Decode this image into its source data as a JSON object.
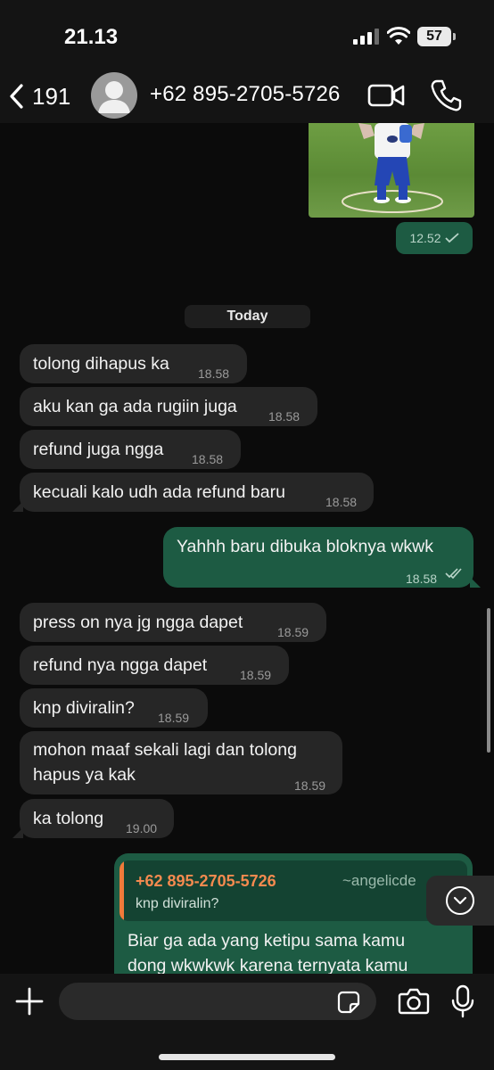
{
  "status_bar": {
    "time": "21.13",
    "battery": "57"
  },
  "header": {
    "back_count": "191",
    "contact_name": "+62 895-2705-5726"
  },
  "image_message": {
    "time": "12.52"
  },
  "date_separator": "Today",
  "messages": [
    {
      "text": "tolong dihapus ka",
      "time": "18.58"
    },
    {
      "text": "aku kan ga ada rugiin juga",
      "time": "18.58"
    },
    {
      "text": "refund juga ngga",
      "time": "18.58"
    },
    {
      "text": "kecuali kalo udh ada refund baru",
      "time": "18.58"
    },
    {
      "text": "Yahhh baru dibuka bloknya wkwk",
      "time": "18.58"
    },
    {
      "text": "press on nya jg ngga dapet",
      "time": "18.59"
    },
    {
      "text": "refund nya ngga dapet",
      "time": "18.59"
    },
    {
      "text": "knp diviralin?",
      "time": "18.59"
    },
    {
      "line1": "mohon maaf sekali lagi dan tolong",
      "line2": "hapus ya kak",
      "time": "18.59"
    },
    {
      "text": "ka tolong",
      "time": "19.00"
    }
  ],
  "reply_message": {
    "quoted_sender": "+62 895-2705-5726",
    "quoted_alias": "~angelicde",
    "quoted_text": "knp diviralin?",
    "line1": "Biar ga ada yang ketipu sama kamu",
    "line2": "dong wkwkwk karena ternyata kamu"
  },
  "colors": {
    "outgoing_bubble": "#1d5b43",
    "incoming_bubble": "#262626",
    "quote_accent": "#f07a3a",
    "background": "#0b0b0b"
  },
  "icons": [
    "back-chevron-icon",
    "avatar-icon",
    "video-call-icon",
    "phone-icon",
    "read-receipt-icon",
    "chevron-down-icon",
    "plus-icon",
    "sticker-icon",
    "camera-icon",
    "microphone-icon"
  ]
}
